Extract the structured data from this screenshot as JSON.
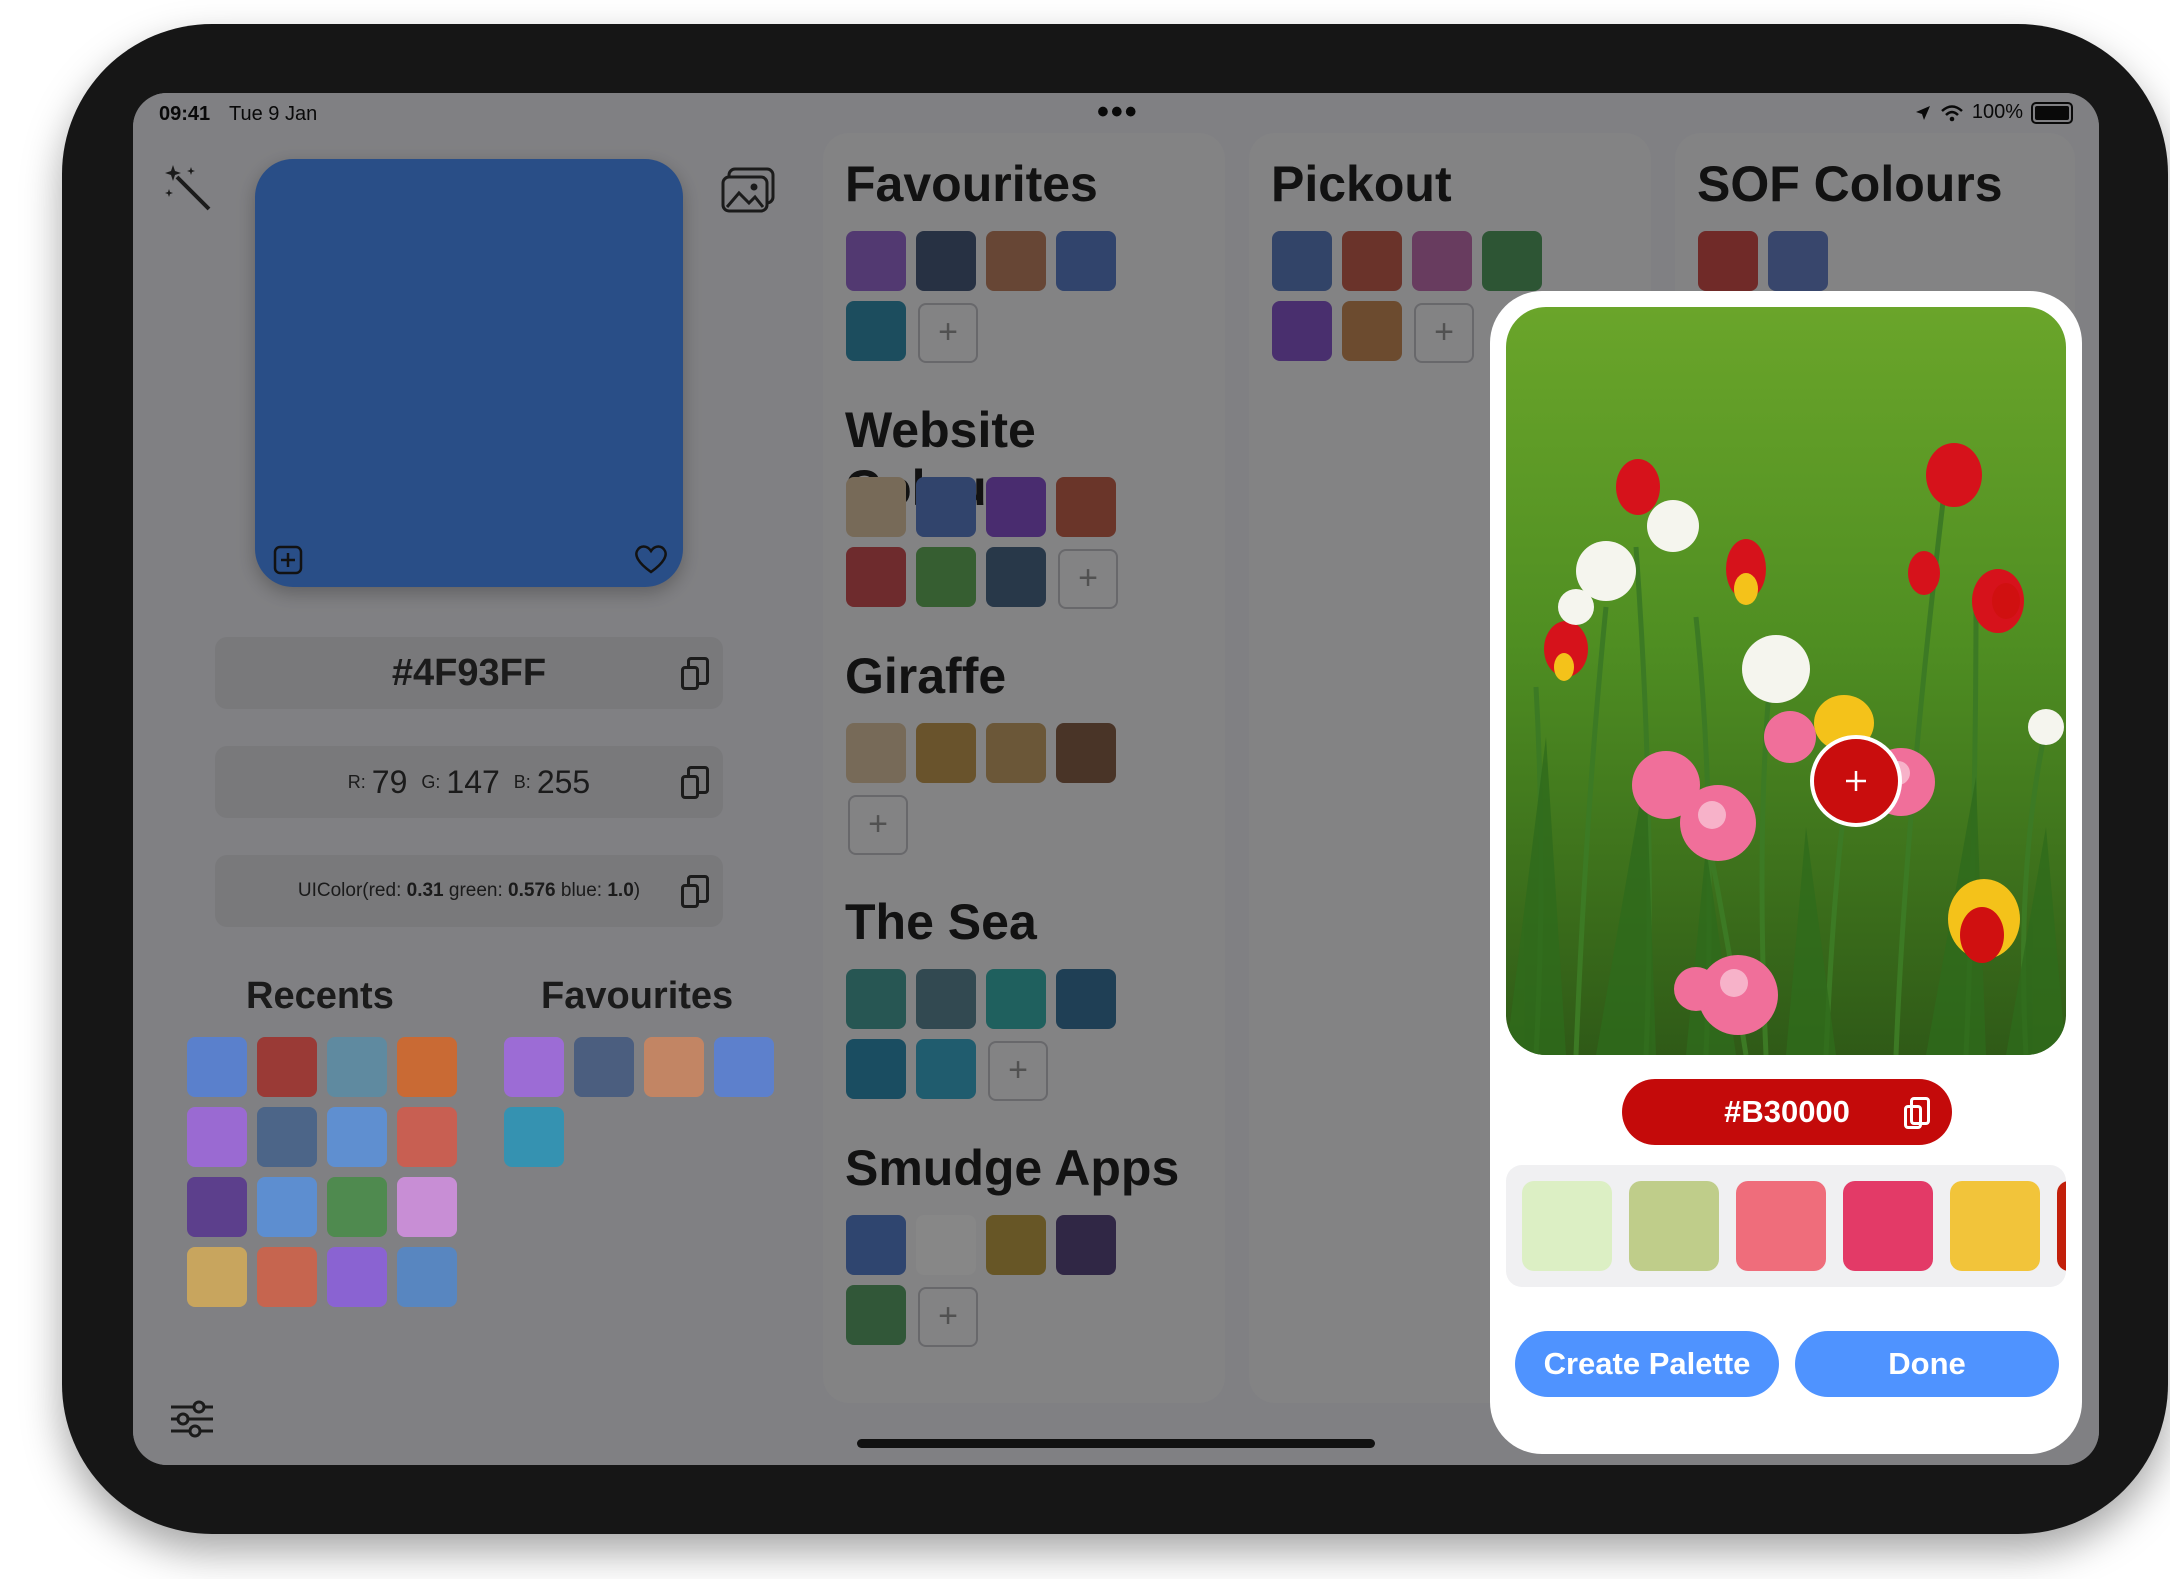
{
  "status_bar": {
    "time": "09:41",
    "date": "Tue 9 Jan",
    "battery": "100%"
  },
  "main": {
    "current_color": "#4F93FF",
    "hex_label": "#4F93FF",
    "rgb": {
      "r_label": "R:",
      "r": "79",
      "g_label": "G:",
      "g": "147",
      "b_label": "B:",
      "b": "255"
    },
    "uicolor": {
      "prefix": "UIColor(red: ",
      "red": "0.31",
      "green_label": " green: ",
      "green": "0.576",
      "blue_label": " blue: ",
      "blue": "1.0",
      "suffix": ")"
    }
  },
  "recents": {
    "title": "Recents",
    "colors": [
      "#5a80cc",
      "#9a3a36",
      "#5f8aa0",
      "#c96a34",
      "#9a6ad2",
      "#4c6588",
      "#5f8fd0",
      "#c85f52",
      "#5c3f8c",
      "#5d8ed0",
      "#4f8a4f",
      "#c88ed5",
      "#c8a55e",
      "#c6654f",
      "#8a63d2",
      "#5886c0"
    ]
  },
  "favourites_small": {
    "title": "Favourites",
    "colors": [
      "#9c6cd5",
      "#4b5e7f",
      "#c28564",
      "#5d80cc",
      "#3592b1"
    ]
  },
  "palettes": [
    {
      "title": "Favourites",
      "colors": [
        "#9c6cd5",
        "#4b5e7f",
        "#c28564",
        "#5d80cc",
        "#3592b1"
      ]
    },
    {
      "title": "Website Colours",
      "colors": [
        "#e0c9a6",
        "#5e80cc",
        "#8a54d2",
        "#c8644f",
        "#d05256",
        "#67b15e",
        "#4d6a8a"
      ]
    },
    {
      "title": "Giraffe",
      "colors": [
        "#e0c9a6",
        "#c69d54",
        "#caa46b",
        "#8a624a"
      ]
    },
    {
      "title": "The Sea",
      "colors": [
        "#4ba39e",
        "#5f8a99",
        "#3bb6b1",
        "#3b78a0",
        "#3292b8",
        "#3eaed0"
      ]
    },
    {
      "title": "Smudge Apps",
      "colors": [
        "#5a82d1",
        "#ffffff",
        "#c2a348",
        "#5c4a82",
        "#5da56a"
      ]
    }
  ],
  "pickout": {
    "title": "Pickout",
    "colors": [
      "#5f80c5",
      "#c86050",
      "#c472b3",
      "#56a162",
      "#8a5ad0",
      "#cc8f5a"
    ]
  },
  "sof": {
    "title": "SOF Colours",
    "colors": [
      "#d3504d",
      "#6a85cc"
    ]
  },
  "picker": {
    "hex": "#B30000",
    "hex_color": "#c40a0a",
    "palette_colors": [
      "#dcefc4",
      "#bfcd8a",
      "#ef6d7b",
      "#e33a67",
      "#f2c43a",
      "#c21f0a"
    ],
    "create_label": "Create Palette",
    "done_label": "Done",
    "accent": "#4f93ff"
  }
}
